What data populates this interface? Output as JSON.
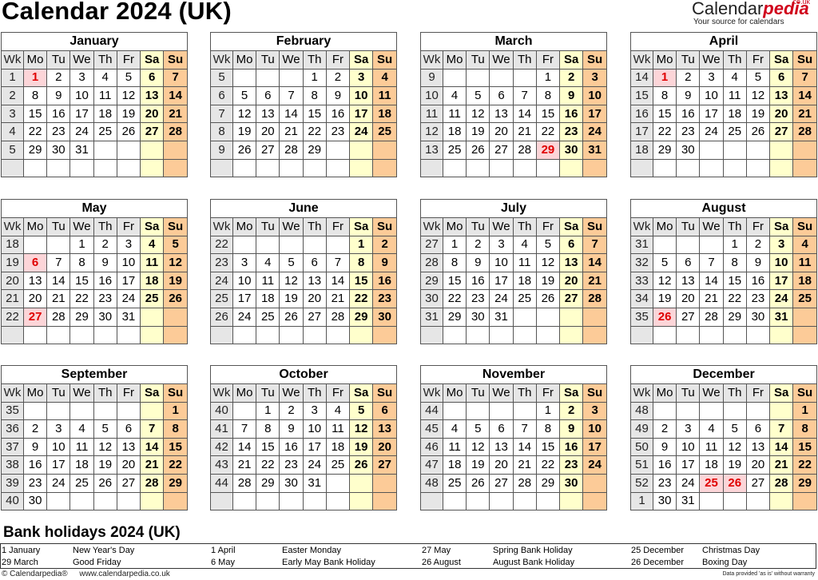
{
  "title": "Calendar 2024 (UK)",
  "brand": {
    "name_main": "Calendar",
    "name_accent": "pedia",
    "domain": "co.uk",
    "tagline": "Your source for calendars"
  },
  "weekday_headers": {
    "wk": "Wk",
    "days": [
      "Mo",
      "Tu",
      "We",
      "Th",
      "Fr",
      "Sa",
      "Su"
    ]
  },
  "colors": {
    "saturday": "#ffffcc",
    "sunday": "#fccb98",
    "holiday_bg": "#fcd5d8",
    "holiday_text": "#e00000",
    "header_bg": "#e6e6e6"
  },
  "months": [
    {
      "name": "January",
      "first_weekday": 0,
      "days": 31,
      "weeks": [
        1,
        2,
        3,
        4,
        5,
        ""
      ],
      "holidays": [
        1
      ]
    },
    {
      "name": "February",
      "first_weekday": 3,
      "days": 29,
      "weeks": [
        5,
        6,
        7,
        8,
        9,
        ""
      ],
      "holidays": []
    },
    {
      "name": "March",
      "first_weekday": 4,
      "days": 31,
      "weeks": [
        9,
        10,
        11,
        12,
        13,
        ""
      ],
      "holidays": [
        29
      ]
    },
    {
      "name": "April",
      "first_weekday": 0,
      "days": 30,
      "weeks": [
        14,
        15,
        16,
        17,
        18,
        ""
      ],
      "holidays": [
        1
      ]
    },
    {
      "name": "May",
      "first_weekday": 2,
      "days": 31,
      "weeks": [
        18,
        19,
        20,
        21,
        22,
        ""
      ],
      "holidays": [
        6,
        27
      ]
    },
    {
      "name": "June",
      "first_weekday": 5,
      "days": 30,
      "weeks": [
        22,
        23,
        24,
        25,
        26,
        ""
      ],
      "holidays": []
    },
    {
      "name": "July",
      "first_weekday": 0,
      "days": 31,
      "weeks": [
        27,
        28,
        29,
        30,
        31,
        ""
      ],
      "holidays": []
    },
    {
      "name": "August",
      "first_weekday": 3,
      "days": 31,
      "weeks": [
        31,
        32,
        33,
        34,
        35,
        ""
      ],
      "holidays": [
        26
      ]
    },
    {
      "name": "September",
      "first_weekday": 6,
      "days": 30,
      "weeks": [
        35,
        36,
        37,
        38,
        39,
        40
      ],
      "holidays": []
    },
    {
      "name": "October",
      "first_weekday": 1,
      "days": 31,
      "weeks": [
        40,
        41,
        42,
        43,
        44,
        ""
      ],
      "holidays": []
    },
    {
      "name": "November",
      "first_weekday": 4,
      "days": 30,
      "weeks": [
        44,
        45,
        46,
        47,
        48,
        ""
      ],
      "holidays": []
    },
    {
      "name": "December",
      "first_weekday": 6,
      "days": 31,
      "weeks": [
        48,
        49,
        50,
        51,
        52,
        1
      ],
      "holidays": [
        25,
        26
      ]
    }
  ],
  "bank_holidays": {
    "title": "Bank holidays 2024 (UK)",
    "items": [
      {
        "date": "1 January",
        "name": "New Year's Day"
      },
      {
        "date": "29 March",
        "name": "Good Friday"
      },
      {
        "date": "1 April",
        "name": "Easter Monday"
      },
      {
        "date": "6 May",
        "name": "Early May Bank Holiday"
      },
      {
        "date": "27 May",
        "name": "Spring Bank Holiday"
      },
      {
        "date": "26 August",
        "name": "August Bank Holiday"
      },
      {
        "date": "25 December",
        "name": "Christmas Day"
      },
      {
        "date": "26 December",
        "name": "Boxing Day"
      }
    ]
  },
  "footer": {
    "copyright": "© Calendarpedia®",
    "url": "www.calendarpedia.co.uk",
    "disclaimer": "Data provided 'as is' without warranty"
  }
}
